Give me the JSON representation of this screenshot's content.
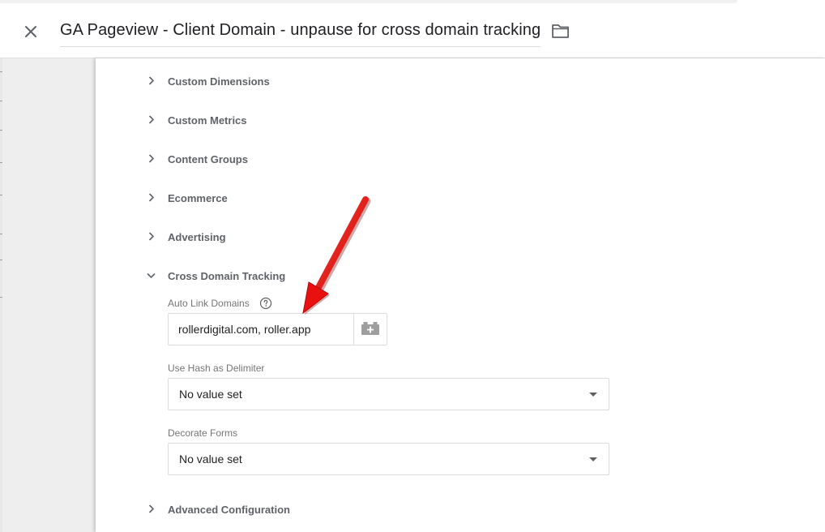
{
  "header": {
    "title": "GA Pageview - Client Domain - unpause for cross domain tracking",
    "close_icon": "close-icon",
    "folder_icon": "folder-icon"
  },
  "sections": {
    "custom_dimensions": "Custom Dimensions",
    "custom_metrics": "Custom Metrics",
    "content_groups": "Content Groups",
    "ecommerce": "Ecommerce",
    "advertising": "Advertising",
    "cross_domain_tracking": "Cross Domain Tracking",
    "advanced_configuration": "Advanced Configuration"
  },
  "cross_domain": {
    "auto_link_label": "Auto Link Domains",
    "auto_link_value": "rollerdigital.com, roller.app",
    "use_hash_label": "Use Hash as Delimiter",
    "use_hash_value": "No value set",
    "decorate_forms_label": "Decorate Forms",
    "decorate_forms_value": "No value set"
  },
  "colors": {
    "annotation_arrow": "#e8110f",
    "section_text": "#5f6368",
    "label_text": "#757575"
  }
}
